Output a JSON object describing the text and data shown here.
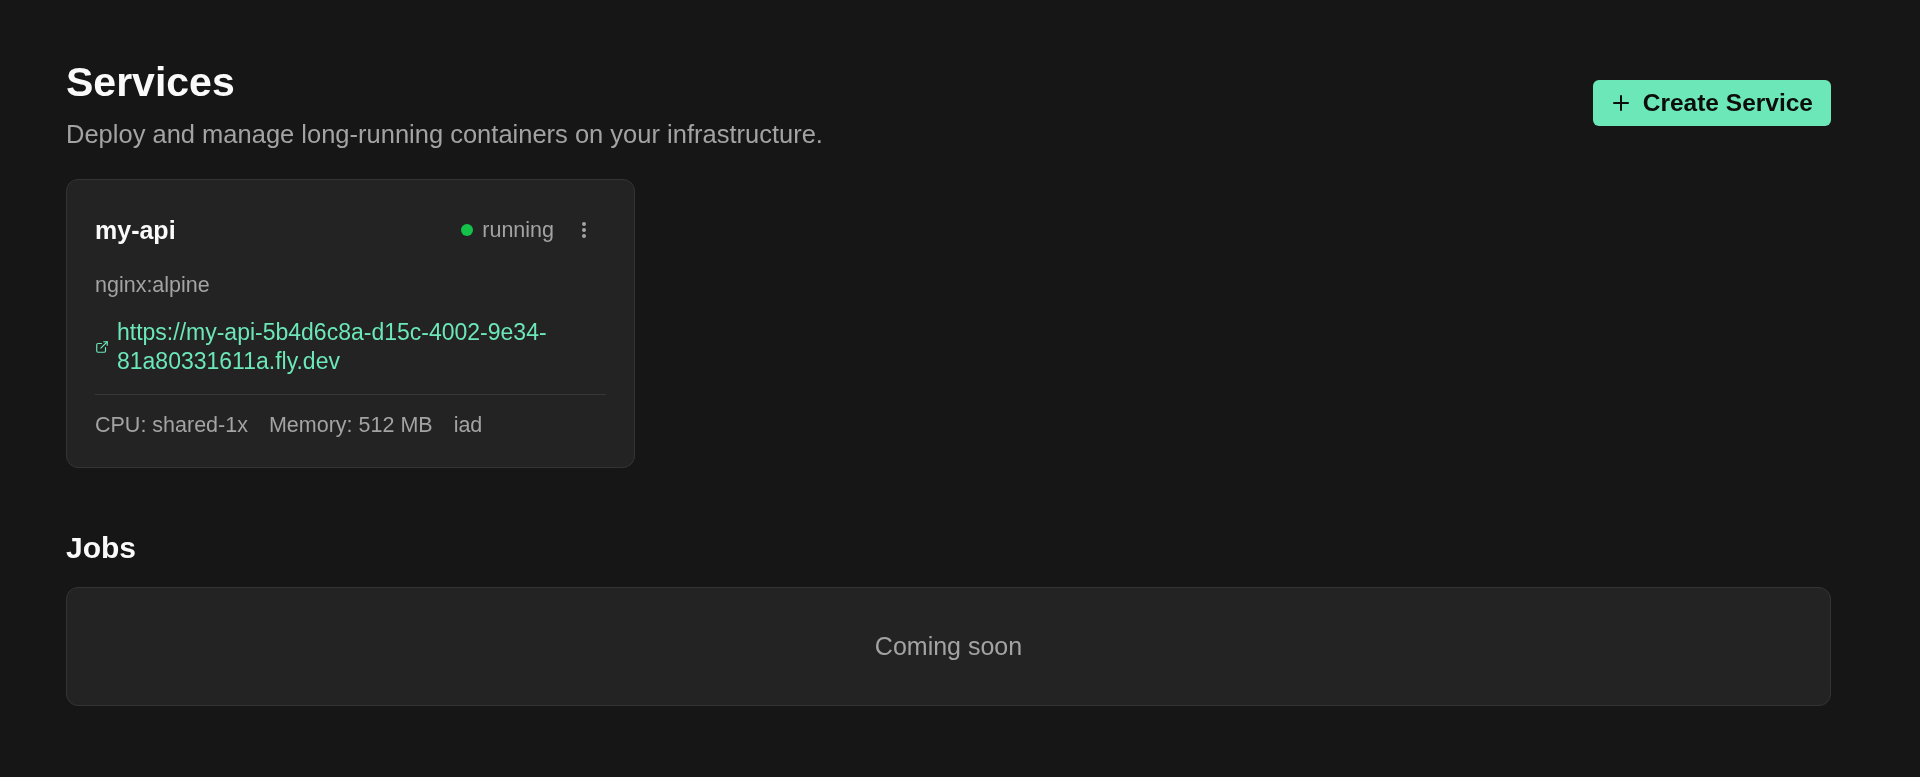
{
  "header": {
    "title": "Services",
    "subtitle": "Deploy and manage long-running containers on your infrastructure.",
    "create_button": {
      "label": "Create Service"
    }
  },
  "services": [
    {
      "name": "my-api",
      "status": "running",
      "color": "#14c24a",
      "image": "nginx:alpine",
      "url": "https://my-api-5b4d6c8a-d15c-4002-9e34-81a80331611a.fly.dev",
      "specs": [
        "CPU: shared-1x",
        "Memory: 512 MB",
        "iad"
      ]
    }
  ],
  "jobs": {
    "title": "Jobs",
    "empty_text": "Coming soon"
  }
}
